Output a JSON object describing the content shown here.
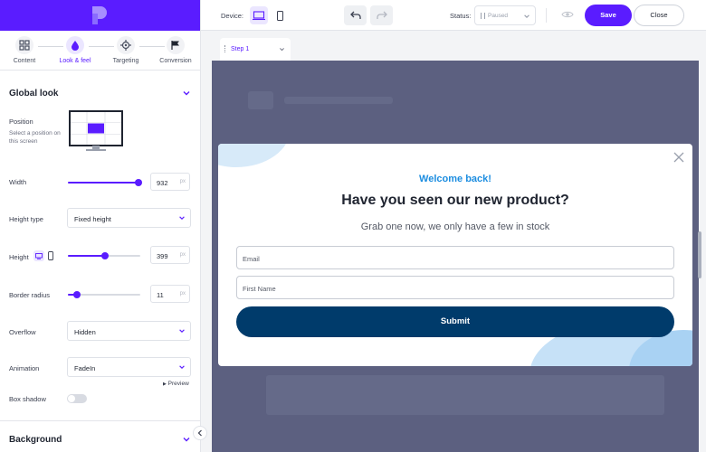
{
  "colors": {
    "brand": "#5a1cff",
    "accent_blue": "#1c8de0",
    "submit_bg": "#003b6b",
    "stage_bg": "#5c6080"
  },
  "sidebar": {
    "steps": [
      {
        "label": "Content",
        "icon": "grid-icon"
      },
      {
        "label": "Look & feel",
        "icon": "droplet-icon",
        "active": true
      },
      {
        "label": "Targeting",
        "icon": "target-icon"
      },
      {
        "label": "Conversion",
        "icon": "flag-icon"
      }
    ],
    "global_look": {
      "title": "Global look",
      "position": {
        "label": "Position",
        "hint": "Select a position on this screen"
      },
      "width": {
        "label": "Width",
        "value": "932",
        "unit": "px",
        "level": 0.97
      },
      "height_type": {
        "label": "Height type",
        "value": "Fixed height"
      },
      "height": {
        "label": "Height",
        "value": "399",
        "unit": "px",
        "level": 0.51
      },
      "border_radius": {
        "label": "Border radius",
        "value": "11",
        "unit": "px",
        "level": 0.13
      },
      "overflow": {
        "label": "Overflow",
        "value": "Hidden"
      },
      "animation": {
        "label": "Animation",
        "value": "FadeIn",
        "preview": "Preview"
      },
      "box_shadow": {
        "label": "Box shadow",
        "on": false
      }
    },
    "background": {
      "title": "Background"
    }
  },
  "toolbar": {
    "device_label": "Device:",
    "status_label": "Status:",
    "status_value": "Paused",
    "save_label": "Save",
    "close_label": "Close"
  },
  "canvas": {
    "step_tab": "Step 1"
  },
  "popup": {
    "welcome": "Welcome back!",
    "title": "Have you seen our new product?",
    "subtitle": "Grab one now, we only have a few in stock",
    "email_placeholder": "Email",
    "first_name_placeholder": "First Name",
    "submit_label": "Submit"
  }
}
